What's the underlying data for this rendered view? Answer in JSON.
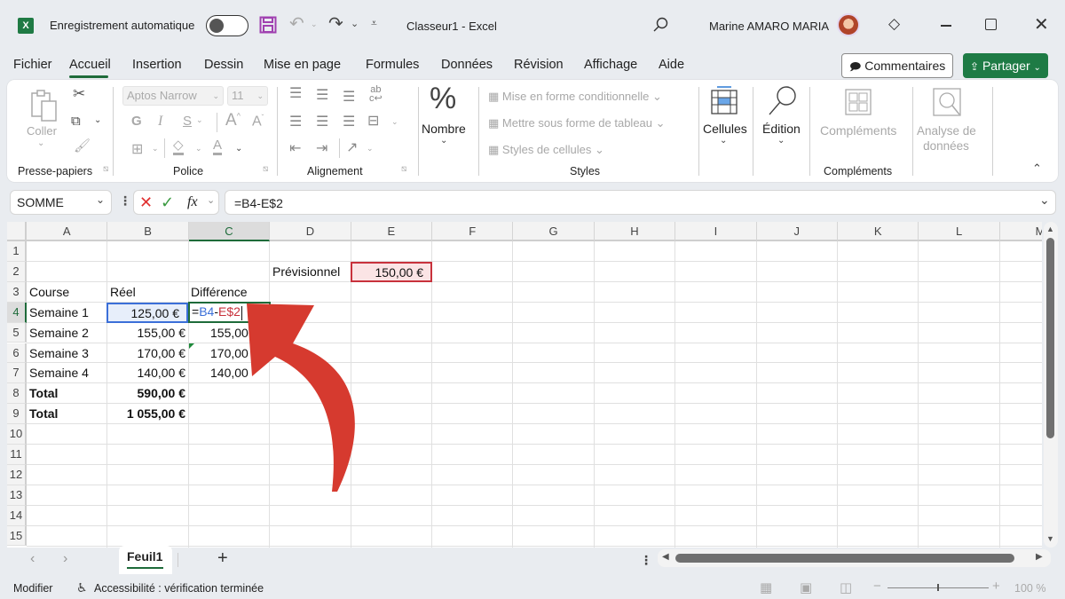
{
  "titlebar": {
    "autosave_label": "Enregistrement automatique",
    "autosave_on": false,
    "doc_title": "Classeur1  -  Excel",
    "user_name": "Marine AMARO MARIA",
    "icons": [
      "excel-logo",
      "save-icon",
      "undo-icon",
      "redo-icon",
      "customize-qat-icon",
      "search-icon",
      "premium-diamond-icon",
      "minimize-icon",
      "maximize-icon",
      "close-icon"
    ]
  },
  "menu": {
    "tabs": [
      "Fichier",
      "Accueil",
      "Insertion",
      "Dessin",
      "Mise en page",
      "Formules",
      "Données",
      "Révision",
      "Affichage",
      "Aide"
    ],
    "active_tab": "Accueil",
    "comments_label": "Commentaires",
    "share_label": "Partager"
  },
  "ribbon": {
    "clipboard": {
      "paste_label": "Coller",
      "group_label": "Presse-papiers"
    },
    "font": {
      "font_name": "Aptos Narrow",
      "font_size": "11",
      "bold": "G",
      "italic": "I",
      "underline": "S",
      "group_label": "Police"
    },
    "alignment": {
      "group_label": "Alignement"
    },
    "number": {
      "label": "Nombre",
      "icon_glyph": "%"
    },
    "styles": {
      "items": [
        "Mise en forme conditionnelle",
        "Mettre sous forme de tableau",
        "Styles de cellules"
      ],
      "group_label": "Styles"
    },
    "cells": {
      "label": "Cellules"
    },
    "editing": {
      "label": "Édition"
    },
    "addins": {
      "label": "Compléments",
      "analyze_label_1": "Analyse de",
      "analyze_label_2": "données",
      "group_label": "Compléments"
    }
  },
  "formula_bar": {
    "name_box": "SOMME",
    "fx": "fx",
    "formula": "=B4-E$2"
  },
  "grid": {
    "columns": [
      "A",
      "B",
      "C",
      "D",
      "E",
      "F",
      "G",
      "H",
      "I",
      "J",
      "K",
      "L",
      "M"
    ],
    "selected_column": "C",
    "rows": [
      "1",
      "2",
      "3",
      "4",
      "5",
      "6",
      "7",
      "8",
      "9",
      "10",
      "11",
      "12",
      "13",
      "14",
      "15"
    ],
    "selected_row": "4",
    "cells": {
      "D2": "Prévisionnel",
      "E2": "150,00 €",
      "A3": "Course",
      "B3": "Réel",
      "C3": "Différence",
      "A4": "Semaine 1",
      "B4": "125,00 €",
      "C4_eq": "=",
      "C4_ref1": "B4",
      "C4_op": "-",
      "C4_ref2": "E$2",
      "A5": "Semaine 2",
      "B5": "155,00 €",
      "C5": "155,00",
      "A6": "Semaine 3",
      "B6": "170,00 €",
      "C6": "170,00",
      "A7": "Semaine 4",
      "B7": "140,00 €",
      "C7": "140,00",
      "A8": "Total",
      "B8": "590,00 €",
      "A9": "Total",
      "B9": "1 055,00 €"
    },
    "ref_colors": {
      "ref1": "#3b6fd8",
      "ref2": "#c8323c"
    }
  },
  "annotation": {
    "arrow_color": "#d63a2f",
    "points_to": "C4"
  },
  "sheets": {
    "tabs": [
      "Feuil1"
    ],
    "active": "Feuil1",
    "add_label": "+"
  },
  "statusbar": {
    "mode": "Modifier",
    "accessibility": "Accessibilité : vérification terminée",
    "zoom": "100 %"
  }
}
